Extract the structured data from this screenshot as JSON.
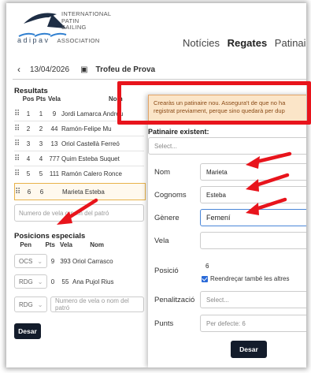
{
  "logo": {
    "lines": [
      "INTERNATIONAL",
      "PATIN",
      "SAILING",
      "ASSOCIATION"
    ],
    "wordmark": "adipav"
  },
  "nav": {
    "items": [
      {
        "label": "Notícies",
        "active": false
      },
      {
        "label": "Regates",
        "active": true
      },
      {
        "label": "Patinaire",
        "active": false
      }
    ]
  },
  "datebar": {
    "back_icon": "chevron-left-icon",
    "date": "13/04/2026",
    "calendar_icon": "calendar-icon",
    "title": "Trofeu de Prova"
  },
  "results": {
    "title": "Resultats",
    "headers": [
      "Pos",
      "Pts",
      "Vela",
      "Nom"
    ],
    "rows": [
      {
        "pos": "1",
        "pts": "1",
        "vela": "9",
        "nom": "Jordi Lamarca Andreu"
      },
      {
        "pos": "2",
        "pts": "2",
        "vela": "44",
        "nom": "Ramón-Felipe Mu"
      },
      {
        "pos": "3",
        "pts": "3",
        "vela": "13",
        "nom": "Oriol Castellà Ferreó"
      },
      {
        "pos": "4",
        "pts": "4",
        "vela": "777",
        "nom": "Quim Esteba Suquet"
      },
      {
        "pos": "5",
        "pts": "5",
        "vela": "111",
        "nom": "Ramón Calero Ronce"
      },
      {
        "pos": "6",
        "pts": "6",
        "vela": "",
        "nom": "Marieta Esteba"
      }
    ],
    "search_placeholder": "Numero de vela o nom del patró"
  },
  "special": {
    "title": "Posicions especials",
    "headers": [
      "Pen",
      "Pts",
      "Vela",
      "Nom"
    ],
    "rows": [
      {
        "pen": "OCS",
        "pts": "9",
        "vela": "393",
        "nom": "Oriol Carrasco"
      },
      {
        "pen": "RDG",
        "pts": "0",
        "vela": "55",
        "nom": "Ana Pujol Rius"
      }
    ],
    "new_pen": "RDG",
    "new_placeholder": "Numero de vela o nom del patró",
    "save_label": "Desar"
  },
  "modal": {
    "warning": [
      "Crearàs un patinaire nou. Assegura't de que no ha",
      "registrat previament, perque sino quedarà per dup"
    ],
    "existing_label": "Patinaire existent:",
    "existing_placeholder": "Select...",
    "fields": {
      "nom_label": "Nom",
      "nom_value": "Marieta",
      "cognoms_label": "Cognoms",
      "cognoms_value": "Esteba",
      "genere_label": "Gènere",
      "genere_value": "Femení",
      "vela_label": "Vela",
      "vela_value": "",
      "posicio_label": "Posició",
      "posicio_value": "6",
      "reorder_label": "Reendreçar també les altres",
      "penalitzacio_label": "Penalització",
      "penalitzacio_placeholder": "Select...",
      "punts_label": "Punts",
      "punts_placeholder": "Per defecte: 6"
    },
    "save_label": "Desar"
  },
  "colors": {
    "annotation_red": "#e8141c",
    "warning_bg": "#fbe5c8",
    "button_dark": "#131c2b"
  }
}
